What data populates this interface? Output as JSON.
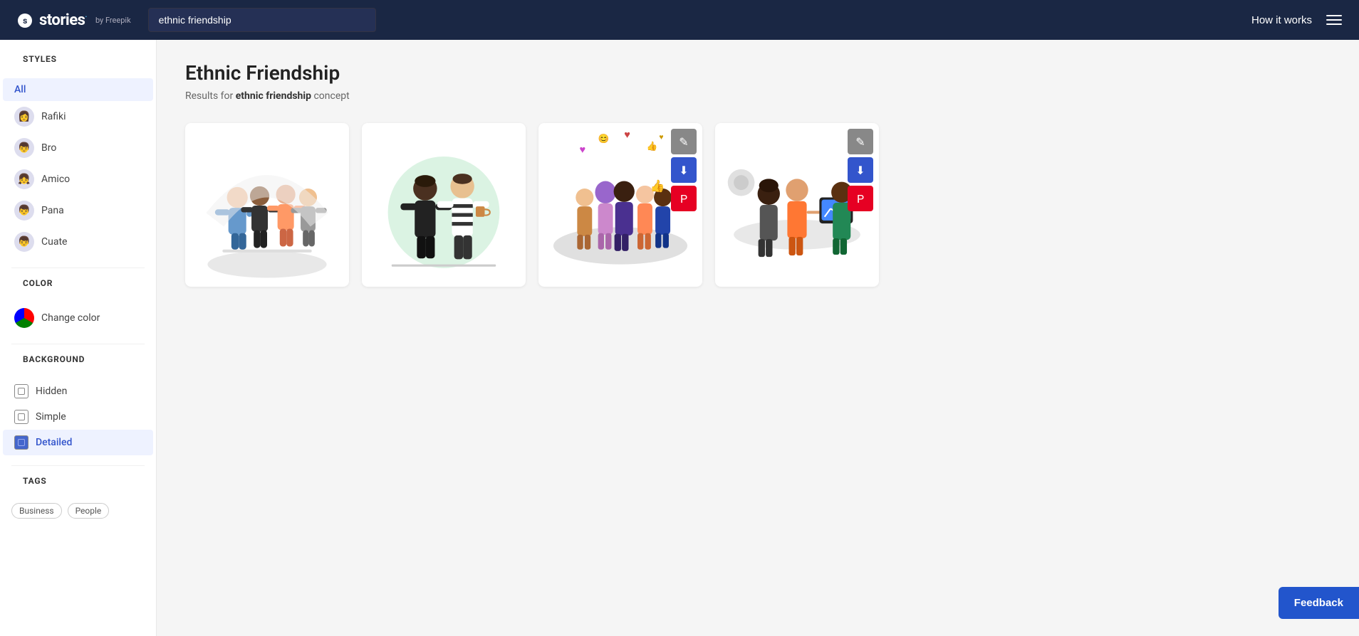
{
  "header": {
    "logo_text": "stories",
    "logo_dot": ".",
    "logo_by": "by Freepik",
    "search_value": "ethnic friendship",
    "search_placeholder": "ethnic friendship",
    "how_it_works": "How it works"
  },
  "sidebar": {
    "styles_title": "STYLES",
    "all_label": "All",
    "style_items": [
      {
        "id": "rafiki",
        "label": "Rafiki",
        "emoji": "👩"
      },
      {
        "id": "bro",
        "label": "Bro",
        "emoji": "👦"
      },
      {
        "id": "amico",
        "label": "Amico",
        "emoji": "👧"
      },
      {
        "id": "pana",
        "label": "Pana",
        "emoji": "👦"
      },
      {
        "id": "cuate",
        "label": "Cuate",
        "emoji": "👦"
      }
    ],
    "color_title": "COLOR",
    "change_color_label": "Change color",
    "background_title": "BACKGROUND",
    "background_items": [
      {
        "id": "hidden",
        "label": "Hidden"
      },
      {
        "id": "simple",
        "label": "Simple"
      },
      {
        "id": "detailed",
        "label": "Detailed"
      }
    ],
    "tags_title": "TAGS",
    "tag_items": [
      {
        "id": "business",
        "label": "Business"
      },
      {
        "id": "people",
        "label": "People"
      }
    ]
  },
  "content": {
    "page_title": "Ethnic Friendship",
    "results_prefix": "Results for ",
    "results_keyword": "ethnic friendship",
    "results_suffix": " concept",
    "cards": [
      {
        "id": 1,
        "alt": "Group of diverse friends illustration",
        "hovered": false
      },
      {
        "id": 2,
        "alt": "Two friends talking illustration",
        "hovered": false
      },
      {
        "id": 3,
        "alt": "Group of diverse women illustration",
        "hovered": true
      },
      {
        "id": 4,
        "alt": "Friends looking at tablet illustration",
        "hovered": true
      }
    ]
  },
  "actions": {
    "edit_label": "✎",
    "download_label": "⬇",
    "pinterest_label": "P"
  },
  "feedback": {
    "label": "Feedback"
  }
}
